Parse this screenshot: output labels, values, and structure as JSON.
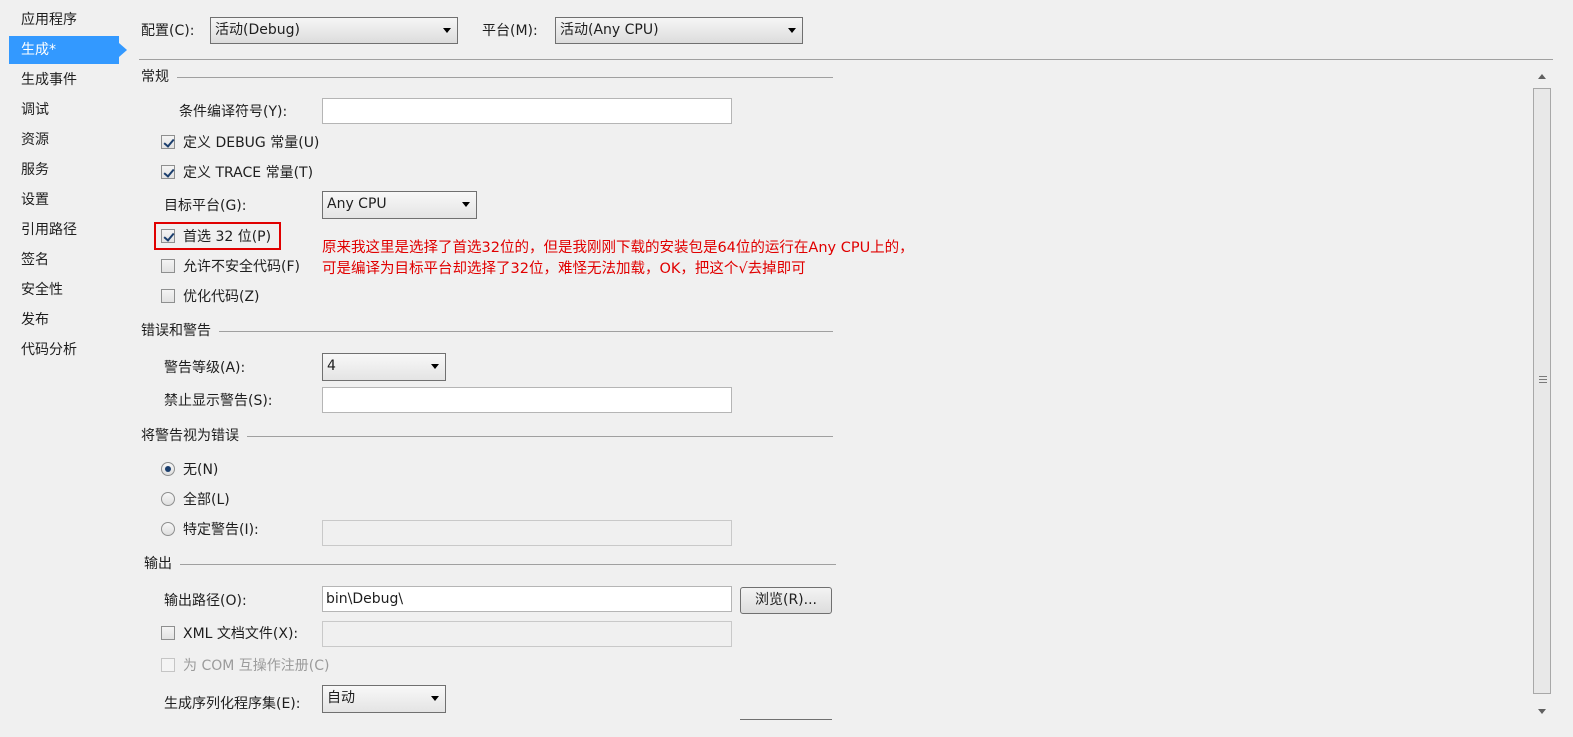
{
  "sidebar": {
    "items": [
      {
        "label": "应用程序"
      },
      {
        "label": "生成*"
      },
      {
        "label": "生成事件"
      },
      {
        "label": "调试"
      },
      {
        "label": "资源"
      },
      {
        "label": "服务"
      },
      {
        "label": "设置"
      },
      {
        "label": "引用路径"
      },
      {
        "label": "签名"
      },
      {
        "label": "安全性"
      },
      {
        "label": "发布"
      },
      {
        "label": "代码分析"
      }
    ],
    "active_index": 1,
    "accent_color": "#3399ff"
  },
  "toolbar": {
    "config_label": "配置(C):",
    "config_value": "活动(Debug)",
    "platform_label": "平台(M):",
    "platform_value": "活动(Any CPU)"
  },
  "general": {
    "title": "常规",
    "conditional_symbols_label": "条件编译符号(Y):",
    "conditional_symbols_value": "",
    "define_debug_label": "定义 DEBUG 常量(U)",
    "define_debug_checked": true,
    "define_trace_label": "定义 TRACE 常量(T)",
    "define_trace_checked": true,
    "target_platform_label": "目标平台(G):",
    "target_platform_value": "Any CPU",
    "prefer32_label": "首选 32 位(P)",
    "prefer32_checked": true,
    "unsafe_label": "允许不安全代码(F)",
    "unsafe_checked": false,
    "optimize_label": "优化代码(Z)",
    "optimize_checked": false
  },
  "annotation": {
    "line1": "原来我这里是选择了首选32位的，但是我刚刚下载的安装包是64位的运行在Any CPU上的，",
    "line2": "可是编译为目标平台却选择了32位，难怪无法加载，OK，把这个√去掉即可",
    "color": "#e00000"
  },
  "errors": {
    "title": "错误和警告",
    "warning_level_label": "警告等级(A):",
    "warning_level_value": "4",
    "suppress_label": "禁止显示警告(S):",
    "suppress_value": ""
  },
  "treat_warnings": {
    "title": "将警告视为错误",
    "none_label": "无(N)",
    "all_label": "全部(L)",
    "specific_label": "特定警告(I):",
    "specific_value": "",
    "selected": "none"
  },
  "output": {
    "title": "输出",
    "path_label": "输出路径(O):",
    "path_value": "bin\\Debug\\",
    "browse_label": "浏览(R)...",
    "xml_doc_label": "XML 文档文件(X):",
    "xml_doc_checked": false,
    "xml_doc_value": "",
    "com_interop_label": "为 COM 互操作注册(C)",
    "com_interop_checked": false,
    "serialization_label": "生成序列化程序集(E):",
    "serialization_value": "自动"
  }
}
